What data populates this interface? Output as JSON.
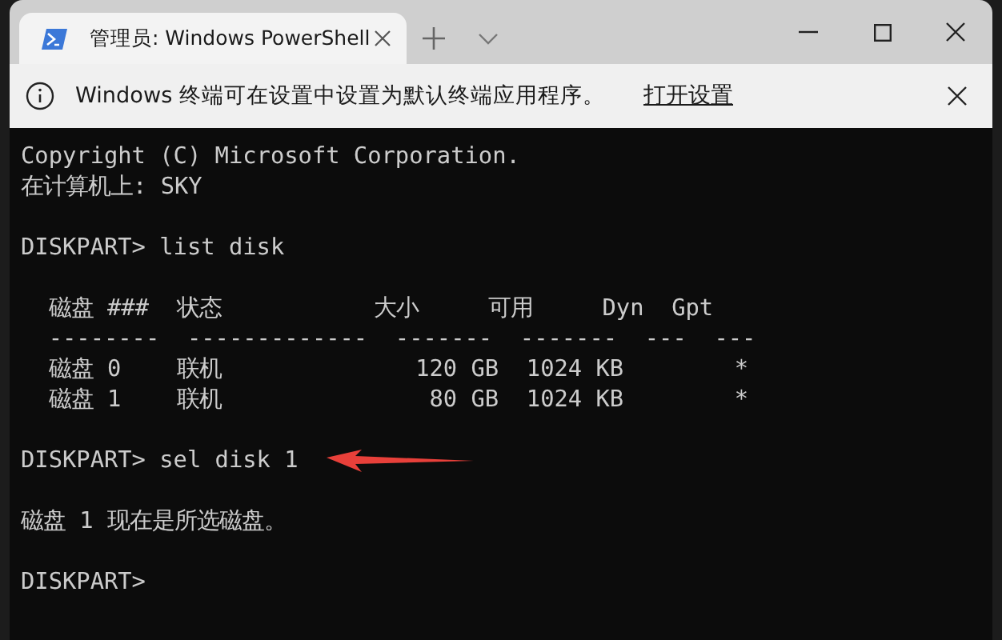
{
  "tabs": [
    {
      "title": "管理员: Windows PowerShell",
      "selected": true
    }
  ],
  "info_bar": {
    "message": "Windows 终端可在设置中设置为默认终端应用程序。",
    "link": "打开设置"
  },
  "terminal": {
    "blocks": [
      [
        "Copyright (C) Microsoft Corporation.",
        "在计算机上: SKY"
      ],
      [
        "DISKPART> list disk"
      ],
      [
        "  磁盘 ###  状态           大小     可用     Dyn  Gpt",
        "  --------  -------------  -------  -------  ---  ---",
        "  磁盘 0    联机              120 GB  1024 KB        *",
        "  磁盘 1    联机               80 GB  1024 KB        *"
      ],
      [
        "DISKPART> sel disk 1"
      ],
      [
        "磁盘 1 现在是所选磁盘。"
      ],
      [
        "DISKPART>"
      ]
    ]
  }
}
